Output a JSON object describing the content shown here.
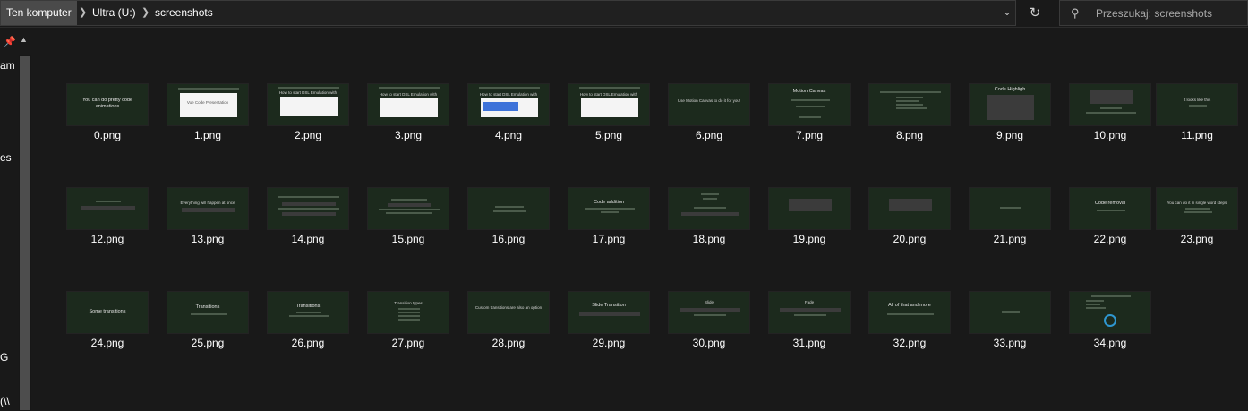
{
  "breadcrumb": {
    "items": [
      "Ten komputer",
      "Ultra (U:)",
      "screenshots"
    ]
  },
  "search": {
    "placeholder": "Przeszukaj: screenshots"
  },
  "nav": {
    "fragments": [
      "am",
      "es",
      "G",
      "(\\\\"
    ]
  },
  "icons": {
    "separator": "chevron-right-icon",
    "dropdown": "chevron-down-icon",
    "refresh": "refresh-icon",
    "search": "search-icon",
    "pin": "pin-icon"
  },
  "files": [
    {
      "name": "0.png",
      "caption": "You can do pretty code animations"
    },
    {
      "name": "1.png",
      "caption": "Vue Code Presentation"
    },
    {
      "name": "2.png",
      "caption": "How to start DSL Emulation with Nanoctrue"
    },
    {
      "name": "3.png",
      "caption": "How to start DSL Emulation with Nanoctrue"
    },
    {
      "name": "4.png",
      "caption": "How to start DSL Emulation with Nanoctrue"
    },
    {
      "name": "5.png",
      "caption": "How to start DSL Emulation with Nanoctrue"
    },
    {
      "name": "6.png",
      "caption": "Use Motion Canvas to do it for you!"
    },
    {
      "name": "7.png",
      "caption": "Motion Canvas"
    },
    {
      "name": "8.png",
      "caption": ""
    },
    {
      "name": "9.png",
      "caption": "Code Highligh"
    },
    {
      "name": "10.png",
      "caption": ""
    },
    {
      "name": "11.png",
      "caption": "It looks like this"
    },
    {
      "name": "12.png",
      "caption": ""
    },
    {
      "name": "13.png",
      "caption": "Everything will happen at once"
    },
    {
      "name": "14.png",
      "caption": ""
    },
    {
      "name": "15.png",
      "caption": ""
    },
    {
      "name": "16.png",
      "caption": ""
    },
    {
      "name": "17.png",
      "caption": "Code addition"
    },
    {
      "name": "18.png",
      "caption": ""
    },
    {
      "name": "19.png",
      "caption": ""
    },
    {
      "name": "20.png",
      "caption": ""
    },
    {
      "name": "21.png",
      "caption": ""
    },
    {
      "name": "22.png",
      "caption": "Code removal"
    },
    {
      "name": "23.png",
      "caption": "You can do it in single word steps"
    },
    {
      "name": "24.png",
      "caption": "Some transitions"
    },
    {
      "name": "25.png",
      "caption": "Transitions"
    },
    {
      "name": "26.png",
      "caption": "Transitions"
    },
    {
      "name": "27.png",
      "caption": "Transition types"
    },
    {
      "name": "28.png",
      "caption": "Custom transitions are also an option"
    },
    {
      "name": "29.png",
      "caption": "Slide Transition"
    },
    {
      "name": "30.png",
      "caption": "Slide"
    },
    {
      "name": "31.png",
      "caption": "Fade"
    },
    {
      "name": "32.png",
      "caption": "All of that and more"
    },
    {
      "name": "33.png",
      "caption": ""
    },
    {
      "name": "34.png",
      "caption": ""
    }
  ]
}
